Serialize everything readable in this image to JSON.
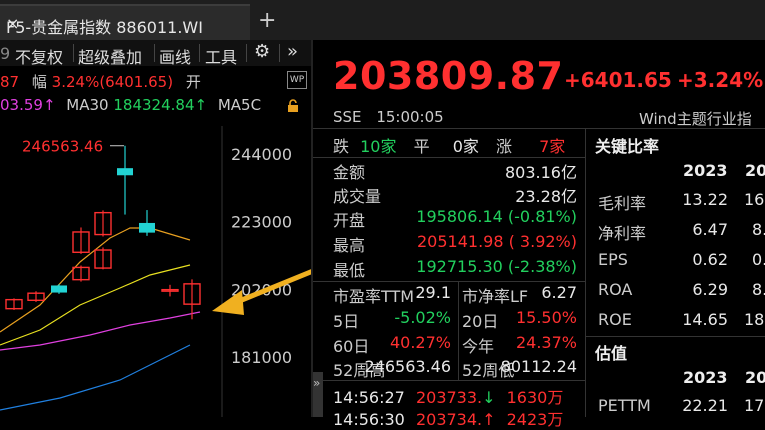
{
  "tab": {
    "title": "F5-贵金属指数 886011.WI",
    "close": "×",
    "new_tab": "+"
  },
  "toolbar": {
    "items": [
      "不复权",
      "超级叠加",
      "画线",
      "工具"
    ],
    "gear": "⚙",
    "more": "»"
  },
  "chart_info": {
    "line1_prefix": "87",
    "line1_label": "幅",
    "line1_value": "3.24%(6401.65)",
    "line1_open": "开",
    "ma_prev": "03.59↑",
    "ma30_label": "MA30",
    "ma30_value": "184324.84↑",
    "ma_next": "MA5C",
    "wp_badge": "WP"
  },
  "colors": {
    "up": "#ff3030",
    "down": "#22d05e",
    "cyan": "#22d3d3",
    "ma_orange": "#e8a020",
    "ma_yellow": "#e8e020",
    "ma_magenta": "#e040e0",
    "ma_blue": "#2080e0",
    "arrow": "#f0b020"
  },
  "chart_data": {
    "type": "candlestick",
    "price_axis_labels": [
      "244000",
      "223000",
      "202000",
      "181000"
    ],
    "high_annotation": "246563.46",
    "candles": [
      {
        "open": 196000,
        "close": 198800,
        "high": 199200,
        "low": 195600
      },
      {
        "open": 198600,
        "close": 200800,
        "high": 201400,
        "low": 198100
      },
      {
        "open": 203200,
        "close": 201000,
        "high": 203600,
        "low": 200600
      },
      {
        "open": 205000,
        "close": 208800,
        "high": 209400,
        "low": 204400
      },
      {
        "open": 208600,
        "close": 214200,
        "high": 215000,
        "low": 208200
      },
      {
        "open": 213500,
        "close": 219800,
        "high": 221200,
        "low": 213000
      },
      {
        "open": 219000,
        "close": 225800,
        "high": 226500,
        "low": 218400
      },
      {
        "open": 239600,
        "close": 237400,
        "high": 246563.46,
        "low": 225200
      },
      {
        "open": 222600,
        "close": 219600,
        "high": 226600,
        "low": 218600
      },
      {
        "open": 201900,
        "close": 201900,
        "high": 203400,
        "low": 199800
      },
      {
        "open": 197400,
        "close": 203700,
        "high": 205100,
        "low": 192700
      }
    ]
  },
  "quote": {
    "price": "203809.87",
    "change": "+6401.65",
    "pct": "+3.24%",
    "exchange": "SSE",
    "time": "15:00:05",
    "industry": "Wind主题行业指"
  },
  "breadth": {
    "down_label": "跌",
    "down": "10家",
    "flat_label": "平",
    "flat": "0家",
    "up_label": "涨",
    "up": "7家"
  },
  "stats": [
    {
      "label": "金额",
      "value": "803.16亿",
      "color": "white"
    },
    {
      "label": "成交量",
      "value": "23.28亿",
      "color": "white"
    },
    {
      "label": "开盘",
      "value": "195806.14 (-0.81%)",
      "color": "green"
    },
    {
      "label": "最高",
      "value": "205141.98 ( 3.92%)",
      "color": "red"
    },
    {
      "label": "最低",
      "value": "192715.30 (-2.38%)",
      "color": "green"
    }
  ],
  "valuation_grid": [
    {
      "l1": "市盈率TTM",
      "v1": "29.1",
      "c1": "white",
      "l2": "市净率LF",
      "v2": "6.27",
      "c2": "white"
    },
    {
      "l1": "5日",
      "v1": "-5.02%",
      "c1": "green",
      "l2": "20日",
      "v2": "15.50%",
      "c2": "red"
    },
    {
      "l1": "60日",
      "v1": "40.27%",
      "c1": "red",
      "l2": "今年",
      "v2": "24.37%",
      "c2": "red"
    },
    {
      "l1": "52周高",
      "v1": "246563.46",
      "c1": "white",
      "l2": "52周低",
      "v2": "80112.24",
      "c2": "white"
    }
  ],
  "ticks": [
    {
      "time": "14:56:27",
      "price": "203733.",
      "arrow": "↓",
      "vol": "1630万"
    },
    {
      "time": "14:56:30",
      "price": "203734.",
      "arrow": "↑",
      "vol": "2423万"
    }
  ],
  "ratios": {
    "title": "关键比率",
    "year1": "2023",
    "year2": "20",
    "rows": [
      {
        "label": "毛利率",
        "v1": "13.22",
        "v2": "16."
      },
      {
        "label": "净利率",
        "v1": "6.47",
        "v2": "8."
      },
      {
        "label": "EPS",
        "v1": "0.62",
        "v2": "0."
      },
      {
        "label": "ROA",
        "v1": "6.29",
        "v2": "8."
      },
      {
        "label": "ROE",
        "v1": "14.65",
        "v2": "18."
      }
    ],
    "val_title": "估值",
    "val_year1": "2023",
    "val_year2": "20",
    "pe_label": "PETTM",
    "pe_v1": "22.21",
    "pe_v2": "17."
  },
  "collapse_glyph": "»"
}
